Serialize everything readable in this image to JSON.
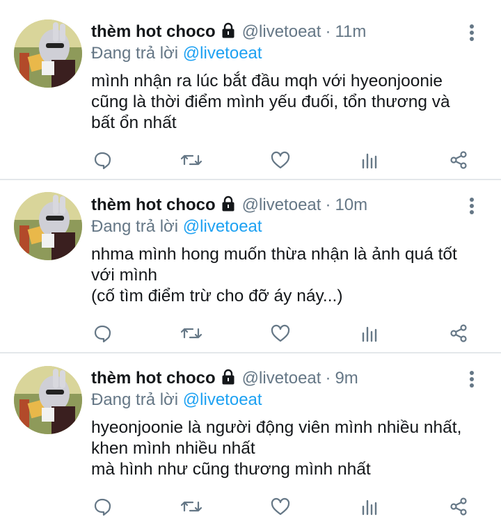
{
  "tweets": [
    {
      "author": {
        "name": "thèm hot choco",
        "handle": "@livetoeat",
        "locked": true
      },
      "time": "11m",
      "reply_prefix": "Đang trả lời",
      "reply_to": "@livetoeat",
      "text": "mình nhận ra lúc bắt đầu mqh với hyeonjoonie\ncũng là thời điểm mình yếu đuối, tổn thương và\nbất ổn nhất"
    },
    {
      "author": {
        "name": "thèm hot choco",
        "handle": "@livetoeat",
        "locked": true
      },
      "time": "10m",
      "reply_prefix": "Đang trả lời",
      "reply_to": "@livetoeat",
      "text": "nhma mình hong muốn thừa nhận là ảnh quá tốt\nvới mình\n(cố tìm điểm trừ cho đỡ áy náy...)"
    },
    {
      "author": {
        "name": "thèm hot choco",
        "handle": "@livetoeat",
        "locked": true
      },
      "time": "9m",
      "reply_prefix": "Đang trả lời",
      "reply_to": "@livetoeat",
      "text": "hyeonjoonie là người động viên mình nhiều nhất,\nkhen mình nhiều nhất\nmà hình như cũng thương mình nhất"
    }
  ],
  "icons": {
    "reply": "reply-icon",
    "retweet": "retweet-icon",
    "like": "heart-icon",
    "analytics": "analytics-icon",
    "share": "share-icon",
    "more": "more-vertical-icon",
    "lock": "lock-icon"
  },
  "colors": {
    "icon": "#657786",
    "mention": "#1da1f2",
    "text": "#14171a"
  }
}
